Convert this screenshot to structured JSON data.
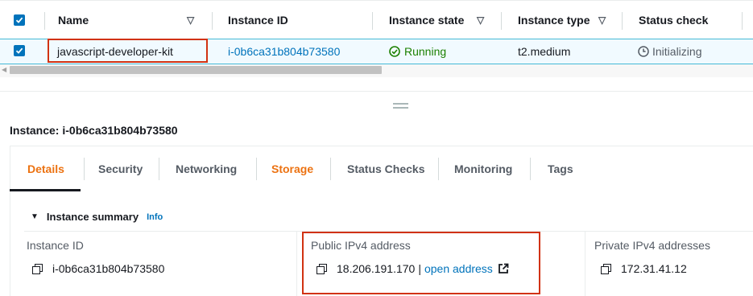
{
  "table": {
    "columns": [
      {
        "label": "Name",
        "sortable": true
      },
      {
        "label": "Instance ID",
        "sortable": false
      },
      {
        "label": "Instance state",
        "sortable": true
      },
      {
        "label": "Instance type",
        "sortable": true
      },
      {
        "label": "Status check",
        "sortable": false
      }
    ],
    "row": {
      "name": "javascript-developer-kit",
      "instance_id": "i-0b6ca31b804b73580",
      "state": "Running",
      "type": "t2.medium",
      "status_check": "Initializing"
    }
  },
  "details": {
    "title": "Instance: i-0b6ca31b804b73580",
    "tabs": [
      "Details",
      "Security",
      "Networking",
      "Storage",
      "Status Checks",
      "Monitoring",
      "Tags"
    ],
    "summary": {
      "heading": "Instance summary",
      "info_link": "Info",
      "instance_id_label": "Instance ID",
      "instance_id_value": "i-0b6ca31b804b73580",
      "public_ipv4_label": "Public IPv4 address",
      "public_ipv4_value": "18.206.191.170",
      "separator": "|",
      "open_address_link": "open address",
      "private_ipv4_label": "Private IPv4 addresses",
      "private_ipv4_value": "172.31.41.12"
    }
  },
  "colors": {
    "accent_blue": "#0073bb",
    "running_green": "#1d8102",
    "highlight_red": "#d13212",
    "tab_orange": "#ec7211"
  }
}
